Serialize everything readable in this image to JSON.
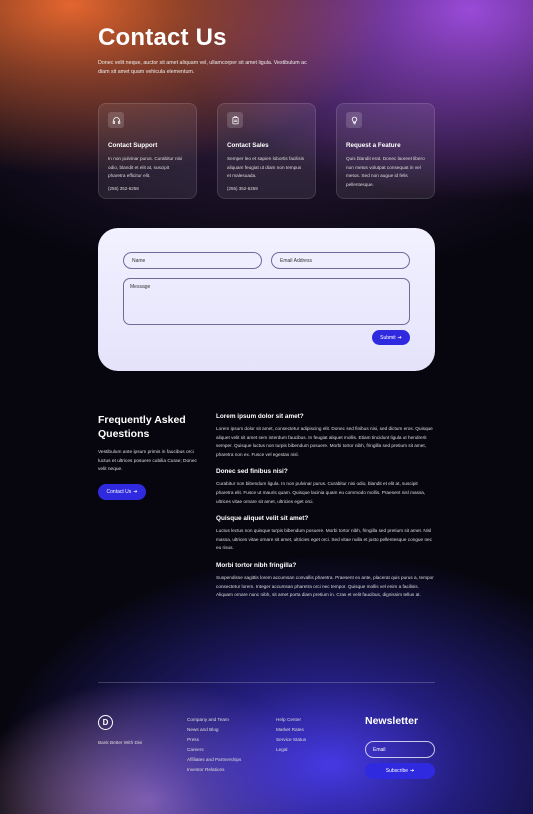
{
  "hero": {
    "title": "Contact Us",
    "description": "Donec velit neque, auctor sit amet aliquam vel, ullamcorper sit amet ligula. Vestibulum ac diam sit amet quam vehicula elementum."
  },
  "cards": [
    {
      "icon": "headphones-icon",
      "title": "Contact Support",
      "text": "In non pulvinar purus. Curabitur nisi odio, blandit et elit at, suscipit pharetra efficitur elit.",
      "phone": "(255) 352-6258"
    },
    {
      "icon": "clipboard-icon",
      "title": "Contact Sales",
      "text": "Semper leo et sapien lobortis facilisis aliquam feugiat ut diam non tempus et malesuada.",
      "phone": "(255) 352-6259"
    },
    {
      "icon": "lightbulb-icon",
      "title": "Request a Feature",
      "text": "Quis blandit erat. Donec laoreet libero non metus volutpat consequat in vel metus. Sed non augue id felis pellentesque.",
      "phone": ""
    }
  ],
  "form": {
    "name_placeholder": "Name",
    "email_placeholder": "Email Address",
    "message_placeholder": "Message",
    "submit_label": "Submit"
  },
  "faq": {
    "title": "Frequently Asked Questions",
    "description": "Vestibulum ante ipsum primis in faucibus orci luctus et ultrices posuere cubilia Curae; Donec velit neque.",
    "button_label": "Contact Us",
    "items": [
      {
        "question": "Lorem ipsum dolor sit amet?",
        "answer": "Lorem ipsum dolor sit amet, consectetur adipiscing elit. Donec sed finibus nisi, sed dictum eros. Quisque aliquet velit sit amet sem interdum faucibus. In feugiat aliquet mollis. Etiam tincidunt ligula ut hendrerit semper. Quisque luctus non turpis bibendum posuere. Morbi tortor nibh, fringilla sed pretium sit amet, pharetra non ex. Fusce vel egestas nisl."
      },
      {
        "question": "Donec sed finibus nisi?",
        "answer": "Curabitur non bibendum ligula. In non pulvinar purus. Curabitur nisi odio, blandit et elit at, suscipit pharetra elit. Fusce ut mauris quam. Quisque lacinia quam eu commodo mollis. Praesent nisl massa, ultrices vitae ornare sit amet, ultricies eget orci."
      },
      {
        "question": "Quisque aliquet velit sit amet?",
        "answer": "Luctus lectus non quisque turpis bibendum posuere. Morbi tortor nibh, fringilla sed pretium sit amet. Nisl massa, ultrices vitae ornare sit amet, ultricies eget orci. Sed vitae nulla et justo pellentesque congue nec eu risus."
      },
      {
        "question": "Morbi tortor nibh fringilla?",
        "answer": "Suspendisse sagittis lorem accumsan convallis pharetra. Praesent ex ante, placerat quis purus a, tempor consectetur lorem. Integer accumsan pharetra orci nec tempor. Quisque mollis vel enim a facilisis. Aliquam ornare nunc nibh, sit amet porta diam pretium in. Cras et velit faucibus, dignissim tellus at."
      }
    ]
  },
  "footer": {
    "logo_letter": "D",
    "tagline": "Bank Better With Divi",
    "col1": [
      "Company and Team",
      "News and Blog",
      "Press",
      "Careers",
      "Affiliates and Partnerships",
      "Investor Relations"
    ],
    "col2": [
      "Help Center",
      "Market Rates",
      "Service Status",
      "Legal"
    ],
    "newsletter_title": "Newsletter",
    "email_placeholder": "Email",
    "subscribe_label": "Subscribe"
  },
  "colors": {
    "accent": "#2f2ae0",
    "hero_orange": "#e3662f",
    "hero_purple": "#9a4ad8"
  }
}
